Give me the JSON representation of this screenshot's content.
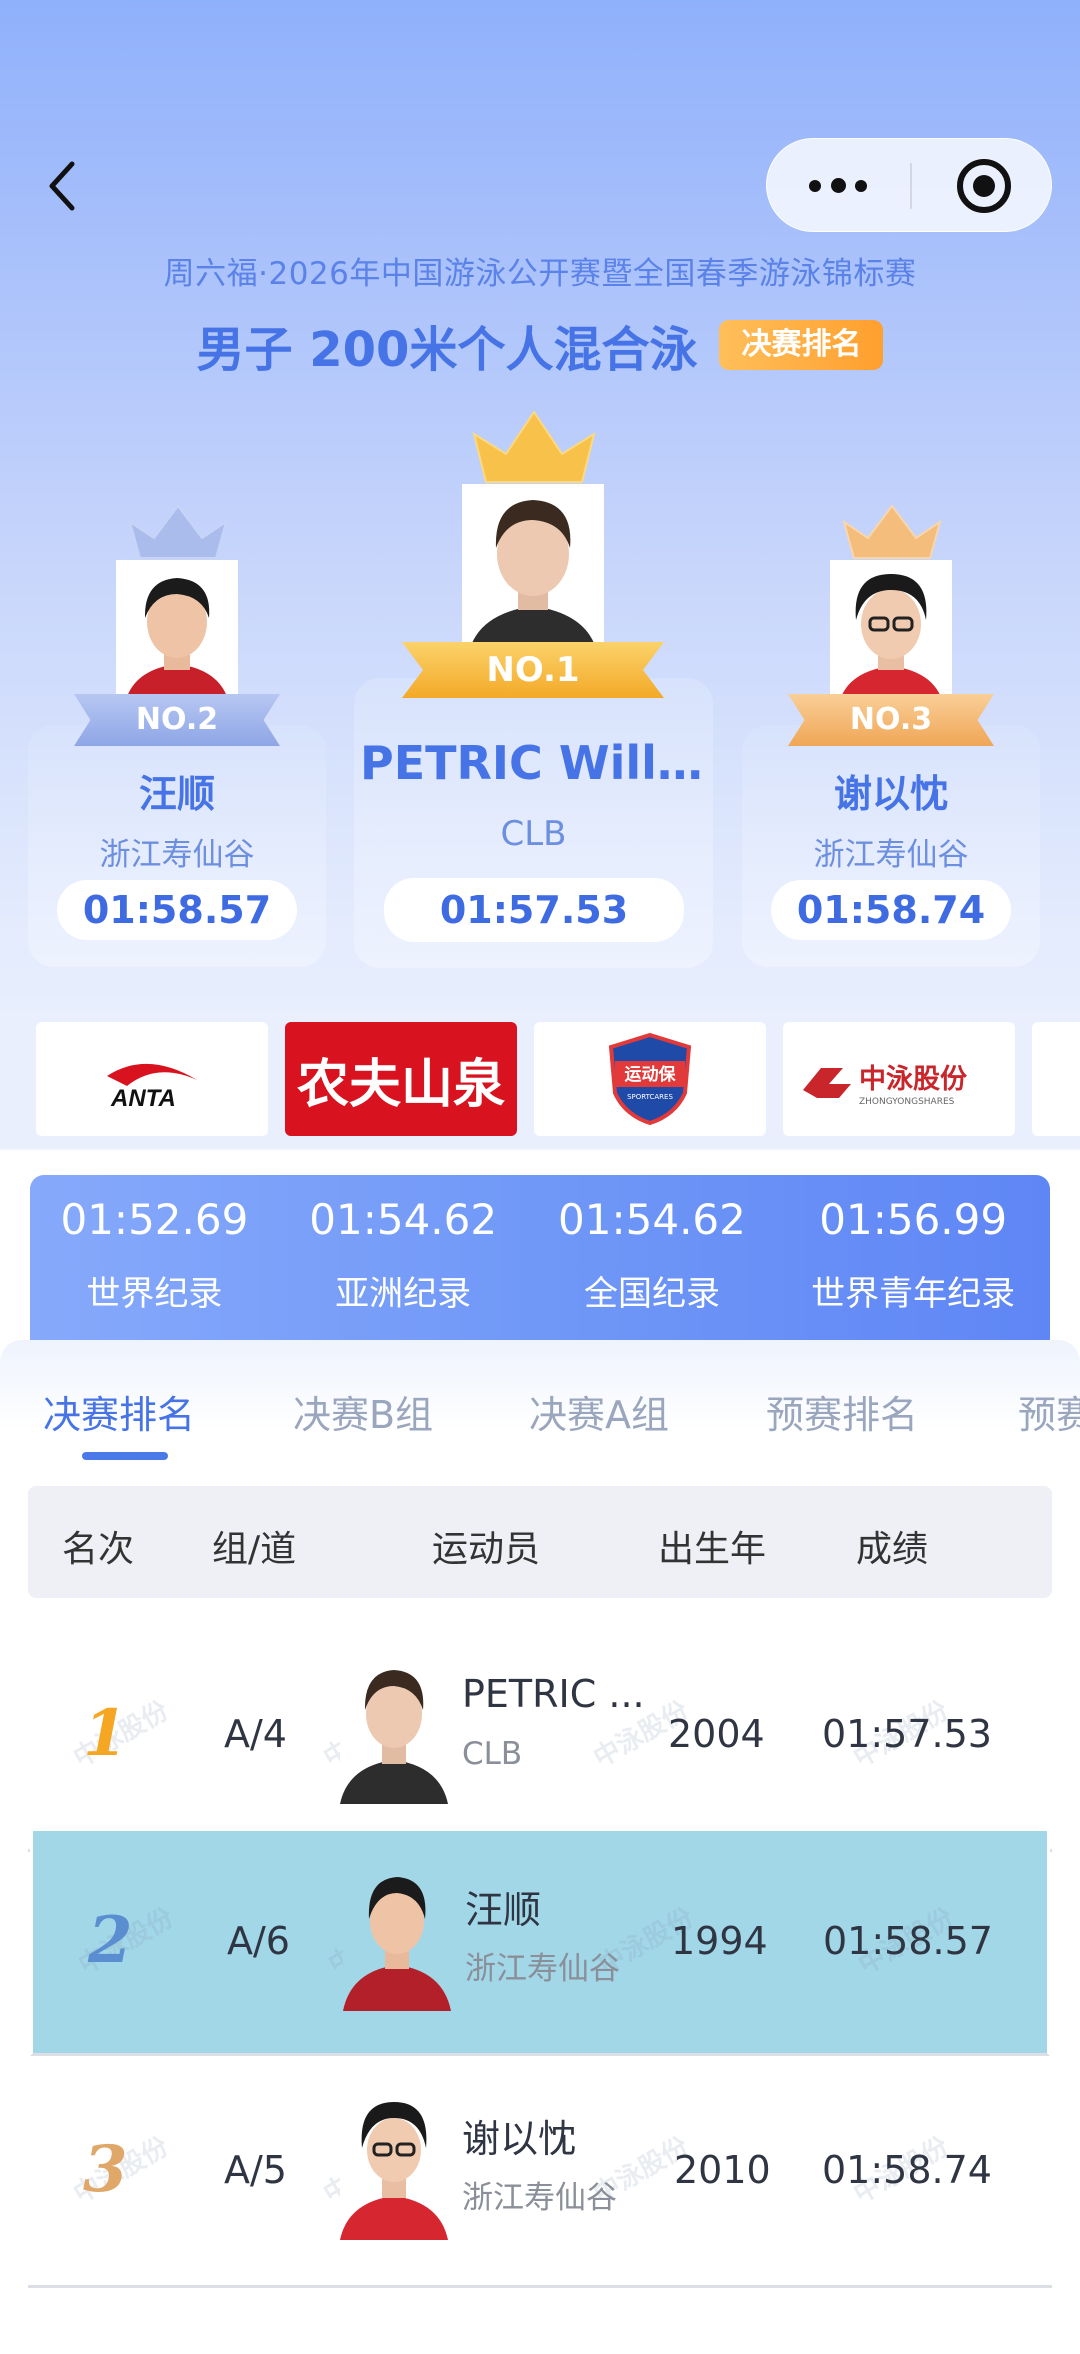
{
  "nav": {
    "back_icon": "chevron-left-icon",
    "more_icon": "more-dots-icon",
    "close_icon": "target-circle-icon"
  },
  "event": {
    "name": "周六福·2026年中国游泳公开赛暨全国春季游泳锦标赛",
    "title": "男子 200米个人混合泳",
    "badge": "决赛排名"
  },
  "podium": {
    "first": {
      "badge": "NO.1",
      "name": "PETRIC Willi...",
      "team": "CLB",
      "time": "01:57.53"
    },
    "second": {
      "badge": "NO.2",
      "name": "汪顺",
      "team": "浙江寿仙谷",
      "time": "01:58.57"
    },
    "third": {
      "badge": "NO.3",
      "name": "谢以忱",
      "team": "浙江寿仙谷",
      "time": "01:58.74"
    }
  },
  "sponsors": {
    "anta": "ANTA",
    "nongfu": "农夫山泉",
    "yundongbao": "运动保",
    "yundongbao_sub": "SPORTCARES",
    "zhongyong": "中泳股份",
    "zhongyong_sub": "ZHONGYONGSHARES"
  },
  "records": [
    {
      "time": "01:52.69",
      "label": "世界纪录"
    },
    {
      "time": "01:54.62",
      "label": "亚洲纪录"
    },
    {
      "time": "01:54.62",
      "label": "全国纪录"
    },
    {
      "time": "01:56.99",
      "label": "世界青年纪录"
    }
  ],
  "tabs": [
    "决赛排名",
    "决赛B组",
    "决赛A组",
    "预赛排名",
    "预赛"
  ],
  "table": {
    "headers": {
      "rank": "名次",
      "lane": "组/道",
      "athlete": "运动员",
      "birth": "出生年",
      "result": "成绩"
    },
    "rows": [
      {
        "rank": "1",
        "lane": "A/4",
        "name": "PETRIC ...",
        "team": "CLB",
        "birth": "2004",
        "result": "01:57.53"
      },
      {
        "rank": "2",
        "lane": "A/6",
        "name": "汪顺",
        "team": "浙江寿仙谷",
        "birth": "1994",
        "result": "01:58.57"
      },
      {
        "rank": "3",
        "lane": "A/5",
        "name": "谢以忱",
        "team": "浙江寿仙谷",
        "birth": "2010",
        "result": "01:58.74"
      }
    ],
    "watermark": "中泳股份"
  },
  "colors": {
    "accent": "#4673e6",
    "gold": "#f5b73b",
    "silver": "#9fb3e8",
    "bronze": "#f2b774",
    "highlight_row": "#a2d7e8"
  }
}
